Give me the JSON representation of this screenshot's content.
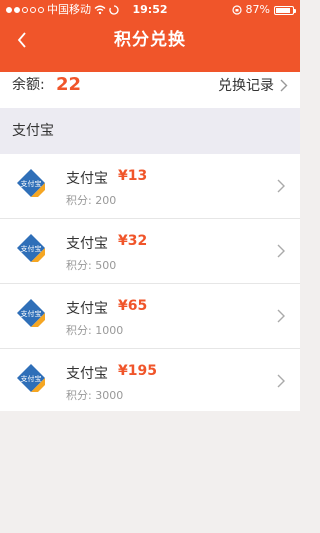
{
  "status_bar": {
    "carrier": "中国移动",
    "time": "19:52",
    "battery": "87%",
    "battery_level": 0.87
  },
  "nav": {
    "title": "积分兑换",
    "back_icon": "chevron-left-icon"
  },
  "balance": {
    "label": "余额:",
    "value": "22",
    "history_label": "兑换记录"
  },
  "section": {
    "title": "支付宝"
  },
  "items": [
    {
      "name": "支付宝",
      "price": "¥13",
      "points": "积分: 200",
      "logo_text": "支付宝"
    },
    {
      "name": "支付宝",
      "price": "¥32",
      "points": "积分: 500",
      "logo_text": "支付宝"
    },
    {
      "name": "支付宝",
      "price": "¥65",
      "points": "积分: 1000",
      "logo_text": "支付宝"
    },
    {
      "name": "支付宝",
      "price": "¥195",
      "points": "积分: 3000",
      "logo_text": "支付宝"
    }
  ],
  "colors": {
    "accent": "#f0552a",
    "background": "#f2efee",
    "section_bg": "#ecebf2",
    "logo_blue": "#2f6fb8",
    "logo_orange": "#f5a623"
  }
}
